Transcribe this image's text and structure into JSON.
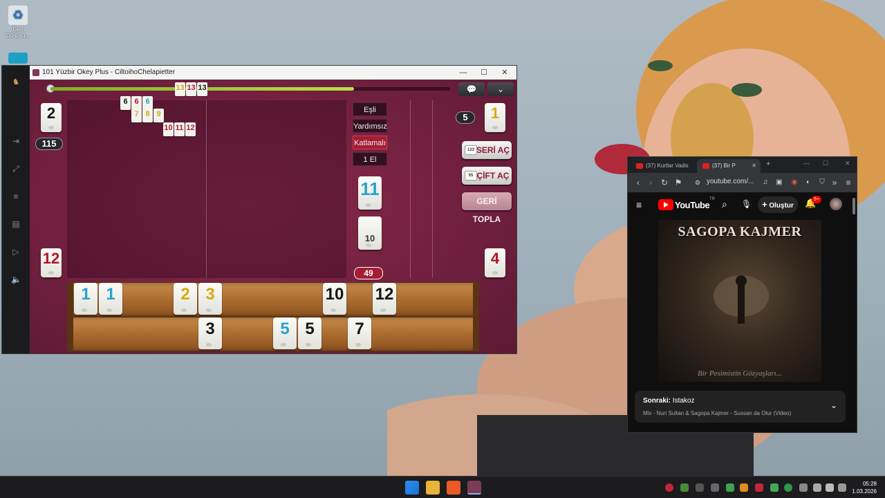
{
  "desktop": {
    "recycle_bin_label": "Geri Dönüşü..."
  },
  "game_window": {
    "title": "101 Yüzbir Okey Plus - CiltoihoChelapietter",
    "controls": {
      "minimize": "—",
      "maximize": "☐",
      "close": "✕"
    },
    "progress_fraction": 0.76,
    "top_buttons": {
      "chat_icon": "chat-bubble-icon",
      "menu_icon": "chevron-down-icon"
    },
    "players": {
      "top_left": {
        "tile": "2",
        "tile_color": "black",
        "score": "115"
      },
      "top_right": {
        "pill": "5",
        "tile": "1",
        "tile_color": "yellow"
      },
      "bottom_left": {
        "tile": "12",
        "tile_color": "red"
      },
      "bottom_right": {
        "tile": "4",
        "tile_color": "red"
      }
    },
    "melds": [
      {
        "tiles": [
          {
            "v": "13",
            "c": "yellow"
          },
          {
            "v": "13",
            "c": "red"
          },
          {
            "v": "13",
            "c": "black"
          }
        ]
      },
      {
        "tiles": [
          {
            "v": "6",
            "c": "black"
          },
          {
            "v": "6",
            "c": "red"
          },
          {
            "v": "6",
            "c": "blue"
          }
        ]
      },
      {
        "tiles": [
          {
            "v": "7",
            "c": "yellow"
          },
          {
            "v": "8",
            "c": "yellow"
          },
          {
            "v": "9",
            "c": "yellow"
          }
        ]
      },
      {
        "tiles": [
          {
            "v": "10",
            "c": "red"
          },
          {
            "v": "11",
            "c": "red"
          },
          {
            "v": "12",
            "c": "red"
          }
        ]
      }
    ],
    "modes": {
      "paired": "Eşli",
      "no_help": "Yardımsız",
      "doubling": "Katlamalı",
      "hands": "1 El"
    },
    "indicator_tile": {
      "value": "11",
      "color": "blue"
    },
    "deck_tile": {
      "value": "10"
    },
    "remaining_count": "49",
    "actions": {
      "series_open": "SERİ AÇ",
      "pair_open": "ÇİFT AÇ",
      "collect": "GERİ TOPLA"
    },
    "rack_top": [
      {
        "v": "1",
        "c": "blue"
      },
      {
        "v": "1",
        "c": "blue"
      },
      {
        "v": "2",
        "c": "yellow"
      },
      {
        "v": "3",
        "c": "yellow"
      },
      {
        "v": "10",
        "c": "black"
      },
      {
        "v": "12",
        "c": "black"
      }
    ],
    "rack_bottom": [
      {
        "v": "3",
        "c": "black"
      },
      {
        "v": "5",
        "c": "blue"
      },
      {
        "v": "5",
        "c": "black"
      },
      {
        "v": "7",
        "c": "black"
      }
    ]
  },
  "browser": {
    "tabs": [
      {
        "label": "(37) Kurtlar Vadis",
        "active": false
      },
      {
        "label": "(37) Bir P",
        "active": true
      }
    ],
    "new_tab": "+",
    "url": "youtube.com/...",
    "youtube": {
      "logo_text": "YouTube",
      "region": "TR",
      "create_label": "Oluştur",
      "notifications": "9+",
      "video_title_art": "SAGOPA KAJMER",
      "video_sub_art": "Bir Pesimistin Gözyaşları...",
      "next_label": "Sonraki:",
      "next_title": "Istakoz",
      "next_sub": "Mix - Nuri Sultan & Sagopa Kajmer - Sussan da Olur (Video)"
    }
  },
  "taskbar": {
    "time": "05:28",
    "date": "1.03.2026"
  }
}
